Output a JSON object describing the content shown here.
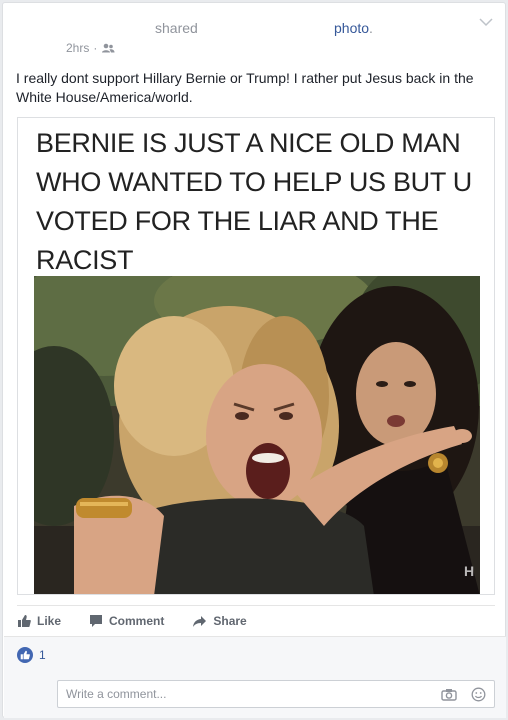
{
  "header": {
    "shared_text": "shared",
    "photo_link": "photo",
    "photo_dot": ".",
    "time": "2hrs",
    "separator": "·"
  },
  "post": {
    "text": "I really dont support Hillary Bernie or Trump! I rather put Jesus back in the White House/America/world."
  },
  "meme": {
    "caption": "BERNIE IS JUST A NICE OLD MAN WHO WANTED TO HELP US BUT U VOTED FOR THE LIAR AND THE RACIST"
  },
  "actions": {
    "like": "Like",
    "comment": "Comment",
    "share": "Share"
  },
  "reactions": {
    "count": "1"
  },
  "comment": {
    "placeholder": "Write a comment..."
  },
  "colors": {
    "link": "#365899",
    "muted": "#90949c",
    "like_blue": "#4267b2"
  }
}
